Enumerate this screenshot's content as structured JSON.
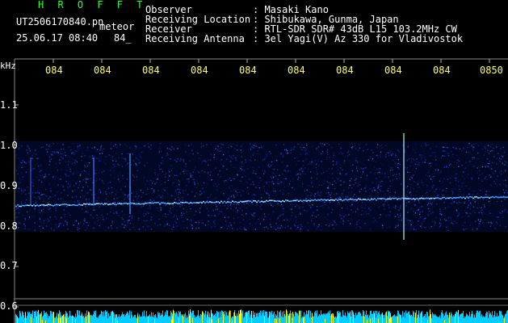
{
  "header": {
    "program": "H R O F F T",
    "filename": "UT2506170840.pn",
    "tag": "meteor",
    "datetime": "25.06.17 08:40",
    "count": "84_"
  },
  "station": {
    "rows": [
      {
        "label": "Observer",
        "value": ": Masaki Kano"
      },
      {
        "label": "Receiving Location",
        "value": ": Shibukawa, Gunma, Japan"
      },
      {
        "label": "Receiver",
        "value": ": RTL-SDR SDR# 43dB L15 103.2MHz CW"
      },
      {
        "label": "Receiving Antenna",
        "value": ": 3el Yagi(V) Az 330 for Vladivostok"
      }
    ]
  },
  "axis": {
    "unit": "kHz",
    "time_ticks": [
      "084",
      "084",
      "084",
      "084",
      "084",
      "084",
      "084",
      "084",
      "084",
      "0850"
    ],
    "freq_ticks": [
      "1.1",
      "1.0",
      "0.9",
      "0.8",
      "0.7",
      "0.6"
    ]
  },
  "colors": {
    "text_green": "#33ff33",
    "text_white": "#ffffff",
    "tick_yellow": "#ffff66",
    "signal_blue": "#2a5cff",
    "noise_floor": "#00ccff",
    "noise_peak": "#ffff00"
  }
}
